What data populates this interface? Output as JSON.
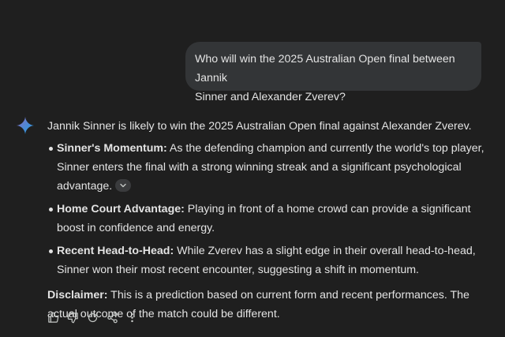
{
  "user_message": {
    "line1": "Who will win the 2025 Australian Open final between Jannik",
    "line2": "Sinner and Alexander Zverev?"
  },
  "response": {
    "intro": "Jannik Sinner is likely to win the 2025 Australian Open final against Alexander Zverev.",
    "bullets": [
      {
        "title": "Sinner's Momentum:",
        "text": " As the defending champion and currently the world's top player, Sinner enters the final with a strong winning streak and a significant psychological advantage."
      },
      {
        "title": "Home Court Advantage:",
        "text": " Playing in front of a home crowd can provide a significant boost in confidence and energy."
      },
      {
        "title": "Recent Head-to-Head:",
        "text": " While Zverev has a slight edge in their overall head-to-head, Sinner won their most recent encounter, suggesting a shift in momentum."
      }
    ],
    "disclaimer_label": "Disclaimer:",
    "disclaimer_text": " This is a prediction based on current form and recent performances. The actual outcome of the match could be different."
  },
  "icons": {
    "assistant": "gemini-spark-icon",
    "source_chip": "chevron-down-icon",
    "actions": [
      "thumbs-up-icon",
      "thumbs-down-icon",
      "regenerate-icon",
      "share-icon",
      "more-vert-icon"
    ]
  },
  "colors": {
    "background": "#1f1f1f",
    "user_bubble": "#333537",
    "text": "#e3e3e3",
    "spark_blue": "#4a8cf7"
  }
}
